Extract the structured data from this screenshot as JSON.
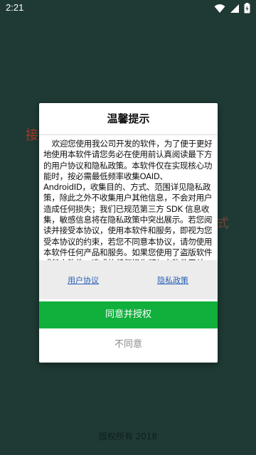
{
  "status_bar": {
    "time": "2:21",
    "icons": [
      "wifi-icon",
      "signal-icon",
      "battery-icon"
    ]
  },
  "background": {
    "ghost_left_text": "接",
    "ghost_right_text": "式",
    "copyright": "版权所有 2018"
  },
  "dialog": {
    "title": "温馨提示",
    "body": "欢迎您使用我公司开发的软件，为了便于更好地使用本软件请您务必在使用前认真阅读最下方的用户协议和隐私政策。本软件仅在实现核心功能时，按必需最低频率收集OAID、AndroidID，收集目的、方式、范围详见隐私政策，除此之外不收集用户其他信息，不会对用户造成任何损失；我们已规范第三方 SDK 信息收集，敏感信息将在隐私政策中突出展示。若您阅读并接受本协议，使用本软件和服务，即视为您受本协议的约束，若您不同意本协议，请勿使用本软件任何产品和服务。如果您使用了盗版软件或其它软件，造成的任何损失都与本软件无关。详细隐私政策和用户协议点击下方链接阅读",
    "user_agreement_link": "用户协议",
    "privacy_policy_link": "隐私政策",
    "agree_button": "同意并授权",
    "disagree_button": "不同意"
  },
  "colors": {
    "background": "#1f3a35",
    "agree_button": "#11b03c",
    "link": "#2a62b8"
  }
}
